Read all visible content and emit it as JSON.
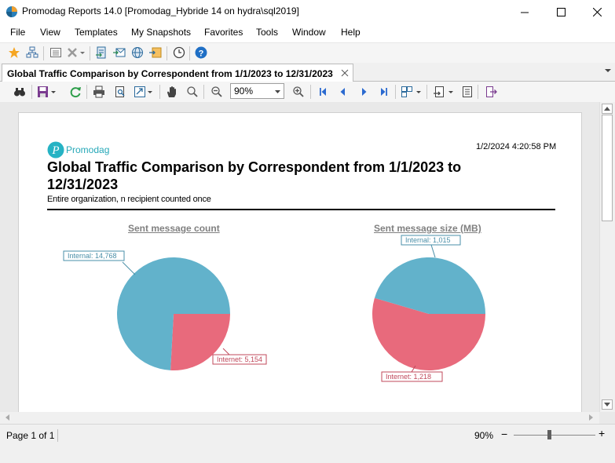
{
  "window": {
    "title": "Promodag Reports 14.0 [Promodag_Hybride 14 on hydra\\sql2019]"
  },
  "menu": {
    "items": [
      "File",
      "View",
      "Templates",
      "My Snapshots",
      "Favorites",
      "Tools",
      "Window",
      "Help"
    ]
  },
  "tab": {
    "label": "Global Traffic Comparison by Correspondent from 1/1/2023 to 12/31/2023"
  },
  "toolbar": {
    "zoom_value": "90%"
  },
  "report": {
    "logo_text": "Promodag",
    "generated": "1/2/2024 4:20:58 PM",
    "title": "Global Traffic Comparison by Correspondent from 1/1/2023 to 12/31/2023",
    "subtitle": "Entire organization, n recipient counted once"
  },
  "charts": [
    {
      "title": "Sent message count",
      "slices": [
        {
          "label": "Internal: 14,768",
          "value": 14768,
          "color": "#62b2cb",
          "label_color": "#4a8fa8"
        },
        {
          "label": "Internet: 5,154",
          "value": 5154,
          "color": "#e86a7c",
          "label_color": "#c0485b"
        }
      ]
    },
    {
      "title": "Sent message size (MB)",
      "slices": [
        {
          "label": "Internal: 1,015",
          "value": 1015,
          "color": "#62b2cb",
          "label_color": "#4a8fa8"
        },
        {
          "label": "Internet: 1,218",
          "value": 1218,
          "color": "#e86a7c",
          "label_color": "#c0485b"
        }
      ]
    }
  ],
  "chart_data": [
    {
      "type": "pie",
      "title": "Sent message count",
      "categories": [
        "Internal",
        "Internet"
      ],
      "values": [
        14768,
        5154
      ]
    },
    {
      "type": "pie",
      "title": "Sent message size (MB)",
      "categories": [
        "Internal",
        "Internet"
      ],
      "values": [
        1015,
        1218
      ]
    }
  ],
  "status": {
    "page_info": "Page 1 of 1",
    "zoom_pct": "90%",
    "zoom_minus": "−",
    "zoom_plus": "+"
  }
}
